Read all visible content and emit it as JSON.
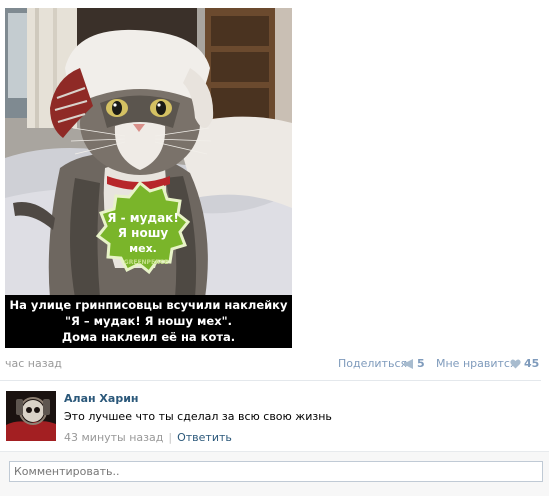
{
  "post": {
    "caption": [
      "На улице гринписовцы всучили наклейку",
      "\"Я – мудак! Я ношу мех\".",
      "Дома наклеил её на кота."
    ],
    "sticker": {
      "lines": [
        "Я - мудак!",
        "Я ношу",
        "мех."
      ],
      "watermark": "GREENPEACE"
    },
    "time": "час назад",
    "share_label": "Поделиться",
    "share_count": "5",
    "like_label": "Мне нравится",
    "like_count": "45"
  },
  "comment": {
    "author": "Алан Харин",
    "text": "Это лучшее что ты сделал за всю свою жизнь",
    "time": "43 минуты назад",
    "reply_label": "Ответить"
  },
  "comment_box": {
    "placeholder": "Комментировать.."
  },
  "colors": {
    "link": "#2b587a",
    "muted": "#999999",
    "action": "#7f9bbc",
    "sticker": "#6aa71b",
    "caption_bg": "#000000"
  },
  "icons": {
    "share": "megaphone-icon",
    "like": "heart-icon"
  }
}
